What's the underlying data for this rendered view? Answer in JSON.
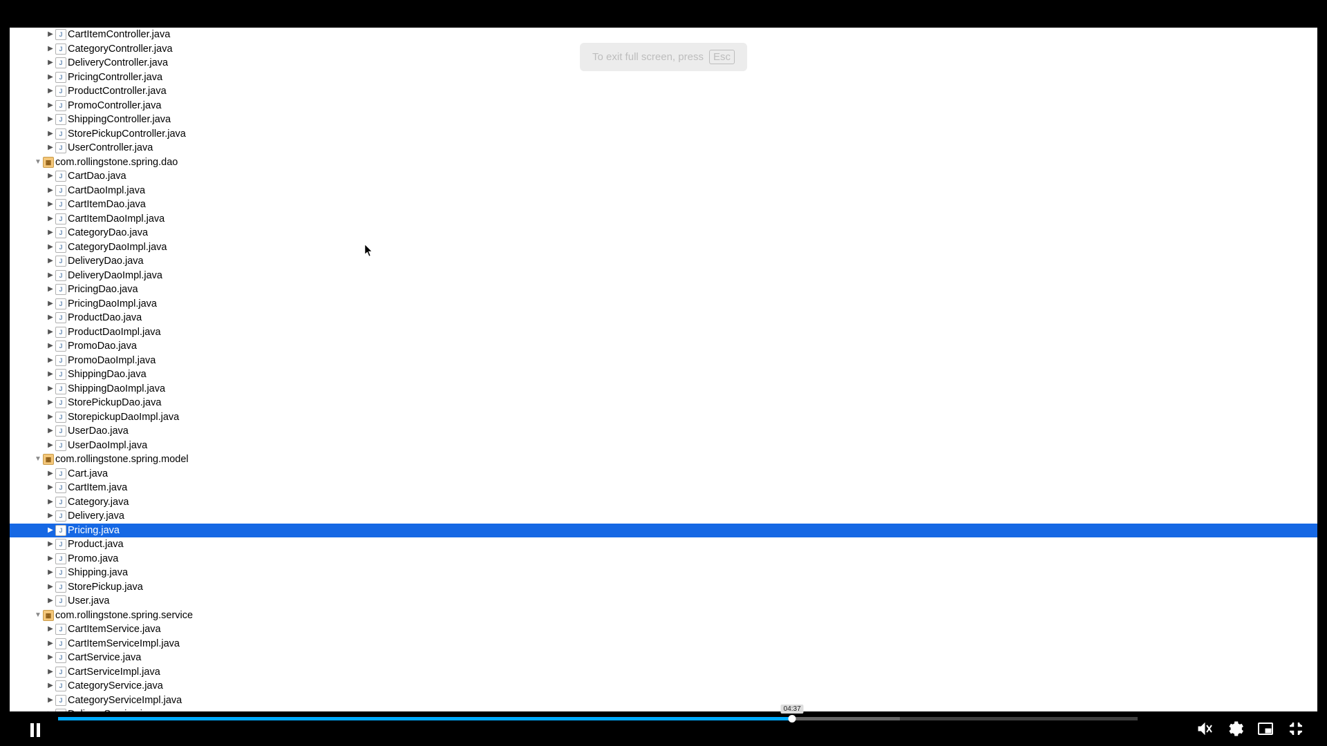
{
  "toast": {
    "text": "To exit full screen, press",
    "key": "Esc"
  },
  "selected": "Pricing.java",
  "controller_files": [
    "CartItemController.java",
    "CategoryController.java",
    "DeliveryController.java",
    "PricingController.java",
    "ProductController.java",
    "PromoController.java",
    "ShippingController.java",
    "StorePickupController.java",
    "UserController.java"
  ],
  "dao_package": "com.rollingstone.spring.dao",
  "dao_files": [
    "CartDao.java",
    "CartDaoImpl.java",
    "CartItemDao.java",
    "CartItemDaoImpl.java",
    "CategoryDao.java",
    "CategoryDaoImpl.java",
    "DeliveryDao.java",
    "DeliveryDaoImpl.java",
    "PricingDao.java",
    "PricingDaoImpl.java",
    "ProductDao.java",
    "ProductDaoImpl.java",
    "PromoDao.java",
    "PromoDaoImpl.java",
    "ShippingDao.java",
    "ShippingDaoImpl.java",
    "StorePickupDao.java",
    "StorepickupDaoImpl.java",
    "UserDao.java",
    "UserDaoImpl.java"
  ],
  "model_package": "com.rollingstone.spring.model",
  "model_files": [
    "Cart.java",
    "CartItem.java",
    "Category.java",
    "Delivery.java",
    "Pricing.java",
    "Product.java",
    "Promo.java",
    "Shipping.java",
    "StorePickup.java",
    "User.java"
  ],
  "service_package": "com.rollingstone.spring.service",
  "service_files": [
    "CartItemService.java",
    "CartItemServiceImpl.java",
    "CartService.java",
    "CartServiceImpl.java",
    "CategoryService.java",
    "CategoryServiceImpl.java",
    "DeliveryService.java"
  ],
  "player": {
    "buffer_pct": 78,
    "played_pct": 68,
    "tooltip_time": "04:37"
  }
}
